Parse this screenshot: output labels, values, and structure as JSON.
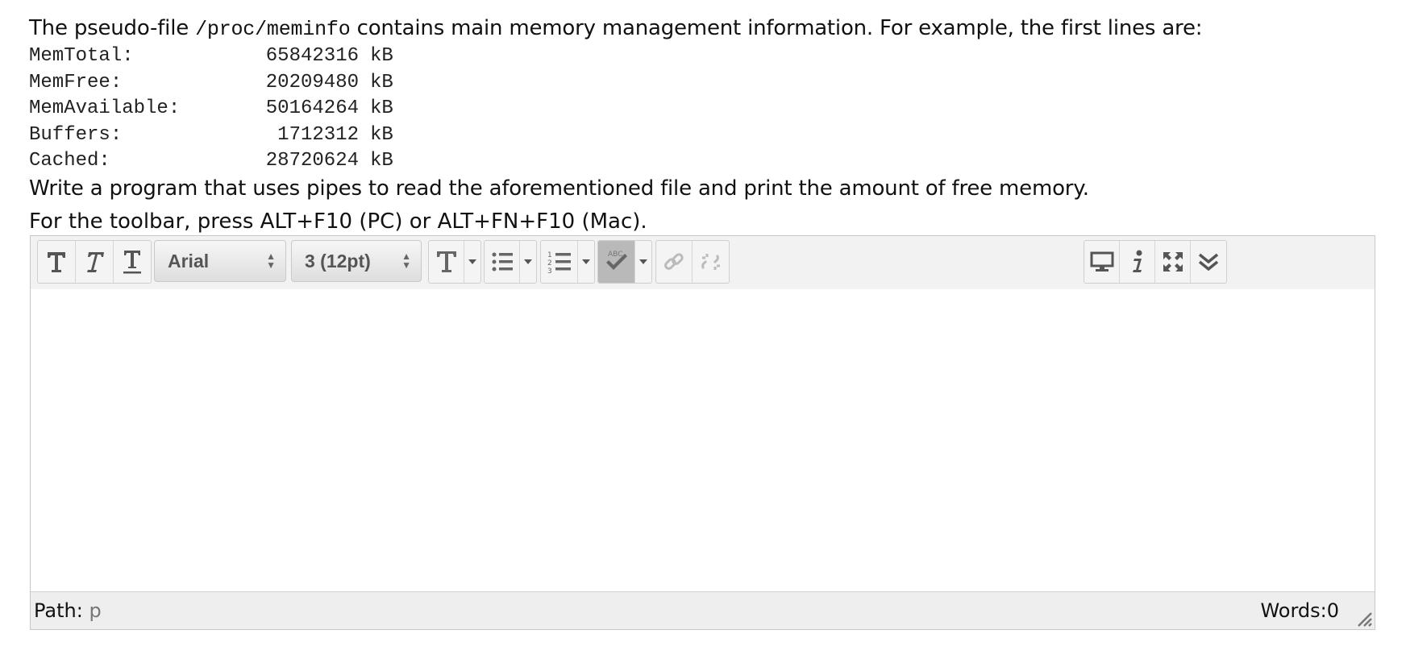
{
  "question": {
    "intro_before": "The pseudo-file ",
    "intro_code": "/proc/meminfo",
    "intro_after": " contains main memory management information. For example, the first lines are:",
    "meminfo": [
      {
        "key": "MemTotal:",
        "value": "65842316",
        "unit": "kB"
      },
      {
        "key": "MemFree:",
        "value": "20209480",
        "unit": "kB"
      },
      {
        "key": "MemAvailable:",
        "value": "50164264",
        "unit": "kB"
      },
      {
        "key": "Buffers:",
        "value": "1712312",
        "unit": "kB"
      },
      {
        "key": "Cached:",
        "value": "28720624",
        "unit": "kB"
      }
    ],
    "task": "Write a program that uses pipes to read the aforementioned file and print the amount of free memory."
  },
  "editor": {
    "hint": "For the toolbar, press ALT+F10 (PC) or ALT+FN+F10 (Mac).",
    "toolbar": {
      "font_family": "Arial",
      "font_size": "3 (12pt)",
      "left_buttons": [
        "bold-icon",
        "italic-icon",
        "underline-icon"
      ],
      "format_buttons": [
        "text-color-icon",
        "bullet-list-icon",
        "numbered-list-icon",
        "spellcheck-icon",
        "link-icon",
        "unlink-icon"
      ],
      "right_buttons": [
        "preview-icon",
        "info-icon",
        "fullscreen-icon",
        "collapse-icon"
      ]
    },
    "content": "",
    "status": {
      "path_label": "Path:",
      "path_value": "p",
      "words": "Words:0"
    }
  }
}
